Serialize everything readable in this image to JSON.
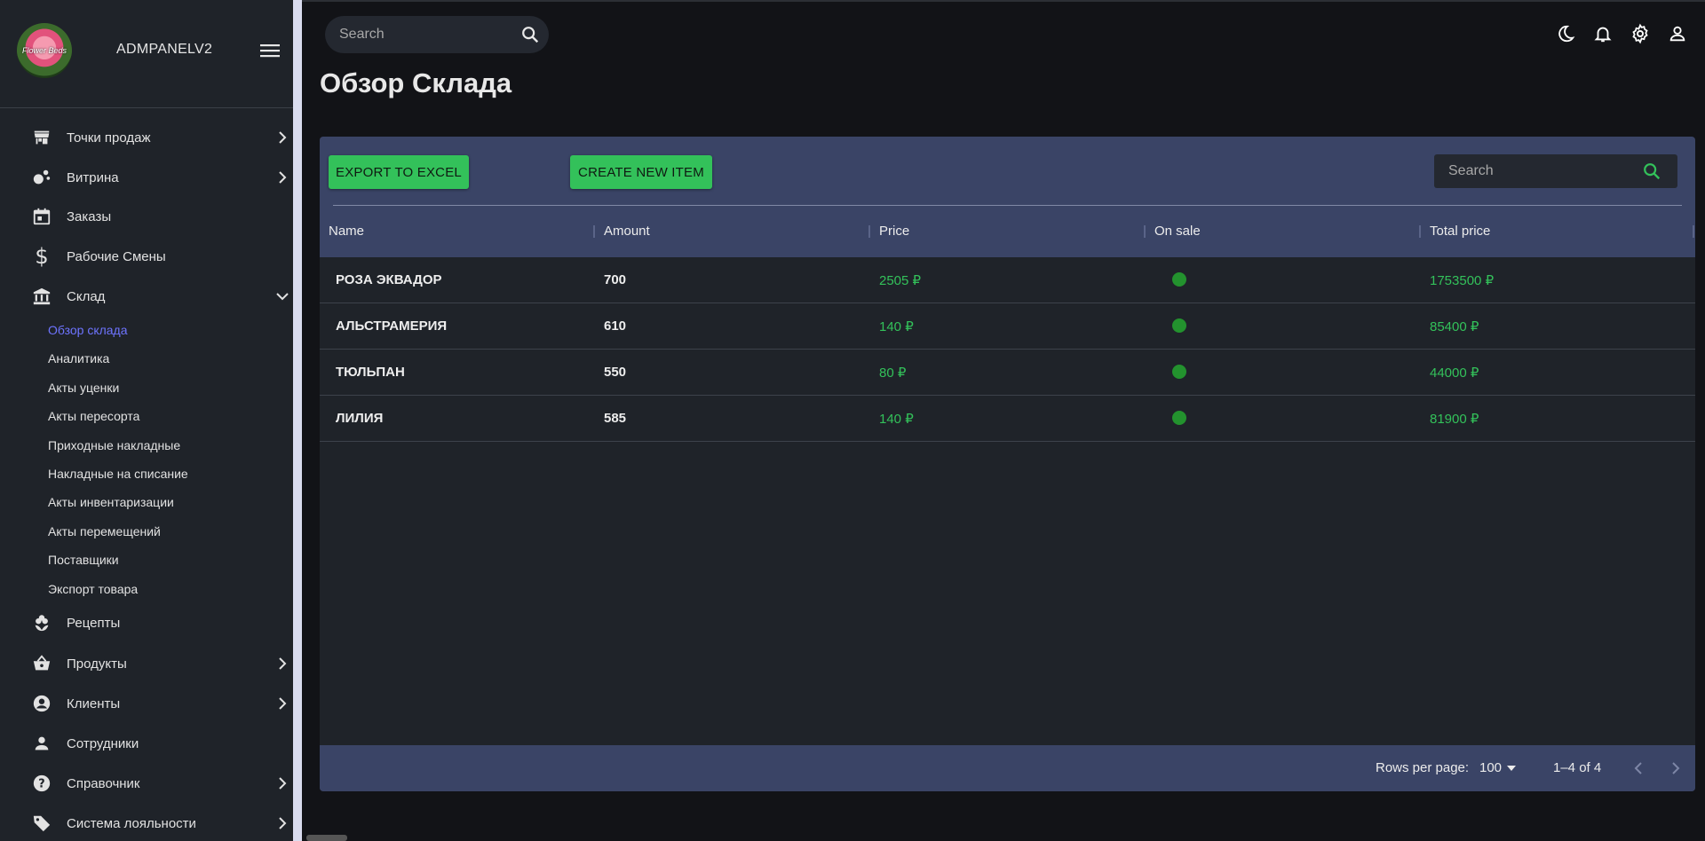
{
  "header": {
    "logo_text": "Flower Beds",
    "brand": "ADMPANELV2",
    "search_placeholder": "Search"
  },
  "sidebar": {
    "items": [
      {
        "label": "Точки продаж",
        "icon": "store-icon",
        "has_chevron": true
      },
      {
        "label": "Витрина",
        "icon": "showcase-icon",
        "has_chevron": true
      },
      {
        "label": "Заказы",
        "icon": "calendar-icon",
        "has_chevron": false
      },
      {
        "label": "Рабочие Смены",
        "icon": "dollar-icon",
        "has_chevron": false
      },
      {
        "label": "Склад",
        "icon": "bank-icon",
        "has_chevron": true,
        "expanded": true
      },
      {
        "label": "Рецепты",
        "icon": "flower-icon",
        "has_chevron": false
      },
      {
        "label": "Продукты",
        "icon": "basket-icon",
        "has_chevron": true
      },
      {
        "label": "Клиенты",
        "icon": "account-circle-icon",
        "has_chevron": true
      },
      {
        "label": "Сотрудники",
        "icon": "person-icon",
        "has_chevron": false
      },
      {
        "label": "Справочник",
        "icon": "help-icon",
        "has_chevron": true
      },
      {
        "label": "Система лояльности",
        "icon": "tag-icon",
        "has_chevron": true
      }
    ],
    "warehouse_sub": [
      "Обзор склада",
      "Аналитика",
      "Акты уценки",
      "Акты пересорта",
      "Приходные накладные",
      "Накладные на списание",
      "Акты инвентаризации",
      "Акты перемещений",
      "Поставщики",
      "Экспорт товара"
    ],
    "active_sub": "Обзор склада"
  },
  "topbar_icons": [
    "moon-icon",
    "bell-icon",
    "gear-icon",
    "user-icon"
  ],
  "page": {
    "title": "Обзор Склада"
  },
  "toolbar": {
    "export_label": "EXPORT TO EXCEL",
    "create_label": "CREATE NEW ITEM",
    "search_placeholder": "Search"
  },
  "table": {
    "columns": [
      "Name",
      "Amount",
      "Price",
      "On sale",
      "Total price"
    ],
    "rows": [
      {
        "name": "РОЗА ЭКВАДОР",
        "amount": "700",
        "price": "2505 ₽",
        "on_sale": true,
        "total": "1753500 ₽"
      },
      {
        "name": "АЛЬСТРАМЕРИЯ",
        "amount": "610",
        "price": "140 ₽",
        "on_sale": true,
        "total": "85400 ₽"
      },
      {
        "name": "ТЮЛЬПАН",
        "amount": "550",
        "price": "80 ₽",
        "on_sale": true,
        "total": "44000 ₽"
      },
      {
        "name": "ЛИЛИЯ",
        "amount": "585",
        "price": "140 ₽",
        "on_sale": true,
        "total": "81900 ₽"
      }
    ]
  },
  "footer": {
    "rows_per_page_label": "Rows per page:",
    "rows_per_page_value": "100",
    "range": "1–4 of 4"
  },
  "colors": {
    "accent_green": "#33c15a",
    "active_link": "#6e74ff",
    "toolbar_bg": "#3a4466"
  }
}
